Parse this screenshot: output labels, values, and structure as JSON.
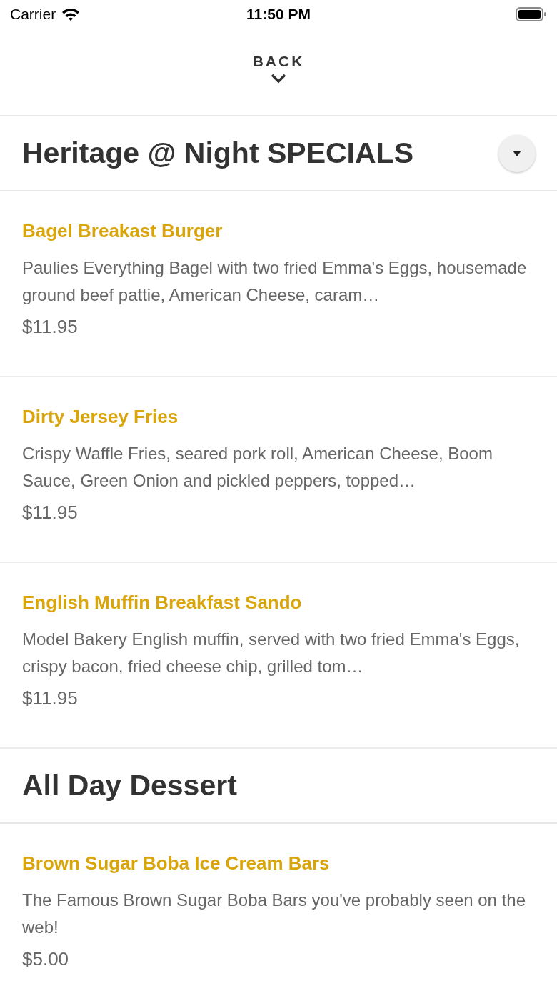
{
  "status_bar": {
    "carrier": "Carrier",
    "time": "11:50 PM"
  },
  "nav": {
    "back": "BACK"
  },
  "sections": [
    {
      "title": "Heritage @ Night SPECIALS",
      "has_toggle": true,
      "items": [
        {
          "name": "Bagel Breakast Burger",
          "description": "Paulies Everything Bagel with two fried Emma's Eggs, housemade ground beef pattie, American Cheese, caram…",
          "price": "$11.95"
        },
        {
          "name": "Dirty Jersey Fries",
          "description": "Crispy Waffle Fries, seared pork roll, American Cheese, Boom Sauce, Green Onion and pickled peppers, topped…",
          "price": "$11.95"
        },
        {
          "name": "English Muffin Breakfast Sando",
          "description": "Model Bakery English muffin, served with two fried Emma's Eggs, crispy bacon, fried cheese chip, grilled tom…",
          "price": "$11.95"
        }
      ]
    },
    {
      "title": "All Day Dessert",
      "has_toggle": false,
      "items": [
        {
          "name": "Brown Sugar Boba Ice Cream Bars",
          "description": "The Famous Brown Sugar Boba Bars you've probably seen on the web!",
          "price": "$5.00"
        }
      ]
    }
  ]
}
